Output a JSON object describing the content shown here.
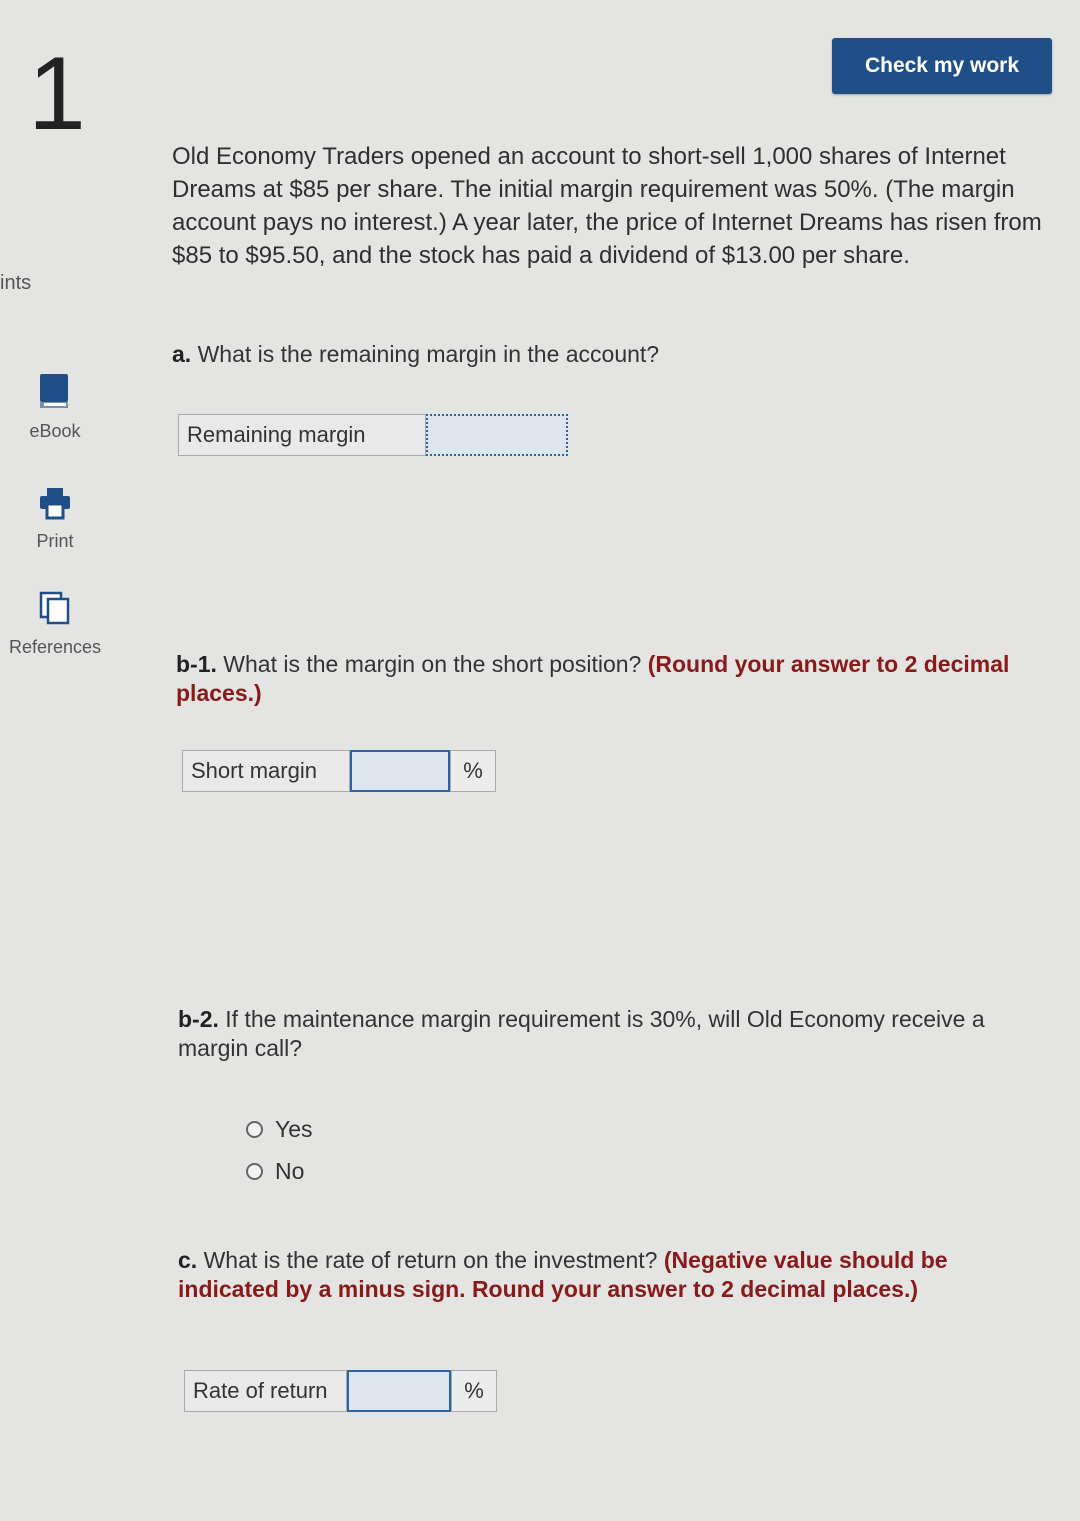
{
  "header": {
    "check_button": "Check my work"
  },
  "sidebar": {
    "question_number": "1",
    "points_label": "ints",
    "tools": [
      {
        "label": "eBook",
        "icon": "book-icon"
      },
      {
        "label": "Print",
        "icon": "printer-icon"
      },
      {
        "label": "References",
        "icon": "references-icon"
      }
    ]
  },
  "problem": {
    "text": "Old Economy Traders opened an account to short-sell 1,000 shares of Internet Dreams at $85 per share. The initial margin requirement was 50%. (The margin account pays no interest.) A year later, the price of Internet Dreams has risen from $85 to $95.50, and the stock has paid a dividend of $13.00 per share."
  },
  "part_a": {
    "prefix": "a.",
    "question": "What is the remaining margin in the account?",
    "field_label": "Remaining margin",
    "value": ""
  },
  "part_b1": {
    "prefix": "b-1.",
    "question": "What is the margin on the short position?",
    "instruction": "(Round your answer to 2 decimal places.)",
    "field_label": "Short margin",
    "value": "",
    "unit": "%"
  },
  "part_b2": {
    "prefix": "b-2.",
    "question": "If the maintenance margin requirement is 30%, will Old Economy receive a margin call?",
    "options": [
      "Yes",
      "No"
    ]
  },
  "part_c": {
    "prefix": "c.",
    "question": "What is the rate of return on the investment?",
    "instruction": "(Negative value should be indicated by a minus sign. Round your answer to 2 decimal places.)",
    "field_label": "Rate of return",
    "value": "",
    "unit": "%"
  },
  "colors": {
    "button_bg": "#1f4f86",
    "emphasis": "#8a1a1a",
    "input_border": "#2f63a8",
    "background": "#e4e5e3"
  }
}
